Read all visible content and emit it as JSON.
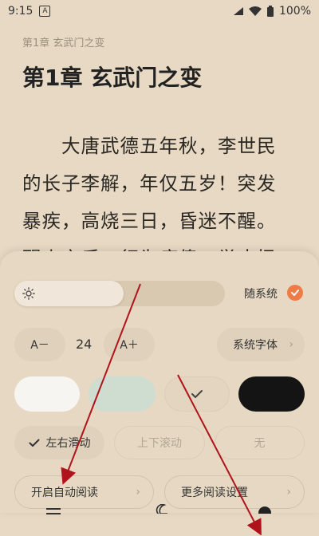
{
  "status_bar": {
    "time": "9:15",
    "notification_badge": "A",
    "battery": "100%"
  },
  "reader": {
    "chapter_small": "第1章 玄武门之变",
    "chapter_title": "第1章 玄武门之变",
    "lines": [
      "　　大唐武德五年秋，李世民",
      "的长子李解，年仅五岁！突发",
      "暴疾，高烧三日，昏迷不醒。",
      "醒来之后，行为痴傻，举止怪"
    ]
  },
  "settings": {
    "follow_system_label": "随系统",
    "follow_system_checked": true,
    "brightness_level": 0.52,
    "font_decrease_label": "A－",
    "font_size_value": "24",
    "font_increase_label": "A＋",
    "font_family_label": "系统字体",
    "themes": [
      {
        "name": "white",
        "color": "#f7f5f2",
        "selected": false
      },
      {
        "name": "mint",
        "color": "#cfdcd0",
        "selected": false
      },
      {
        "name": "paper",
        "color": "#e6d8c2",
        "selected": true
      },
      {
        "name": "black",
        "color": "#141414",
        "selected": false
      }
    ],
    "flip_modes": [
      {
        "label": "左右滑动",
        "selected": true
      },
      {
        "label": "上下滚动",
        "selected": false
      },
      {
        "label": "无",
        "selected": false
      }
    ],
    "auto_read_label": "开启自动阅读",
    "more_settings_label": "更多阅读设置"
  },
  "colors": {
    "accent": "#ef7b46",
    "background": "#e7d9c3",
    "arrow": "#b0131b"
  }
}
